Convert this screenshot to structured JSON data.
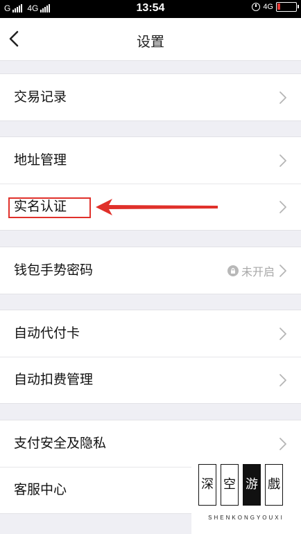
{
  "status_bar": {
    "carrier_1": "G",
    "carrier_2": "4G",
    "time": "13:54",
    "network": "4G",
    "battery_color": "#e53935"
  },
  "nav": {
    "title": "设置",
    "back_icon": "chevron-left-icon"
  },
  "groups": [
    {
      "items": [
        {
          "label": "交易记录"
        }
      ]
    },
    {
      "items": [
        {
          "label": "地址管理"
        },
        {
          "label": "实名认证"
        }
      ]
    },
    {
      "items": [
        {
          "label": "钱包手势密码",
          "status": "未开启",
          "status_icon": "lock-icon"
        }
      ]
    },
    {
      "items": [
        {
          "label": "自动代付卡"
        },
        {
          "label": "自动扣费管理"
        }
      ]
    },
    {
      "items": [
        {
          "label": "支付安全及隐私"
        },
        {
          "label": "客服中心"
        }
      ]
    }
  ],
  "annotation": {
    "color": "#e0302a"
  },
  "watermark": {
    "seal_chars": [
      "深",
      "空",
      "游",
      "戲"
    ],
    "text": "SHENKONGYOUXI"
  }
}
